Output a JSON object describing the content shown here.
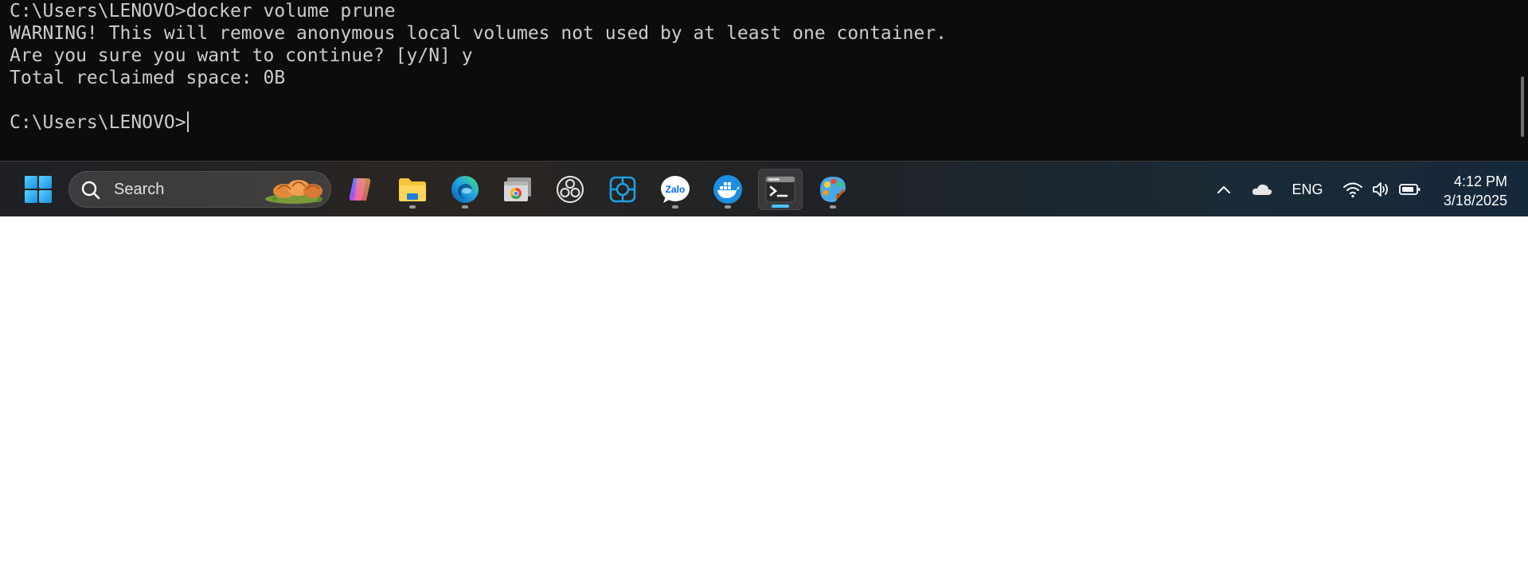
{
  "terminal": {
    "lines": [
      "C:\\Users\\LENOVO>docker volume prune",
      "WARNING! This will remove anonymous local volumes not used by at least one container.",
      "Are you sure you want to continue? [y/N] y",
      "Total reclaimed space: 0B",
      "",
      "C:\\Users\\LENOVO>"
    ],
    "colors": {
      "background": "#0c0c0c",
      "text": "#cccccc"
    }
  },
  "taskbar": {
    "search": {
      "label": "Search"
    },
    "apps": [
      {
        "icon": "windows-start-icon",
        "running": false
      },
      {
        "icon": "copilot-icon",
        "running": false
      },
      {
        "icon": "file-explorer-icon",
        "running": true
      },
      {
        "icon": "edge-icon",
        "running": true
      },
      {
        "icon": "chrome-window-icon",
        "running": false
      },
      {
        "icon": "obs-icon",
        "running": false
      },
      {
        "icon": "screen-capture-icon",
        "running": false
      },
      {
        "icon": "zalo-icon",
        "label": "Zalo",
        "running": true
      },
      {
        "icon": "docker-icon",
        "running": true
      },
      {
        "icon": "terminal-icon",
        "running": true,
        "active": true
      },
      {
        "icon": "paint-icon",
        "running": true
      }
    ],
    "tray": {
      "language": "ENG",
      "time": "4:12 PM",
      "date": "3/18/2025"
    },
    "accent_color": "#4cc2ff"
  }
}
